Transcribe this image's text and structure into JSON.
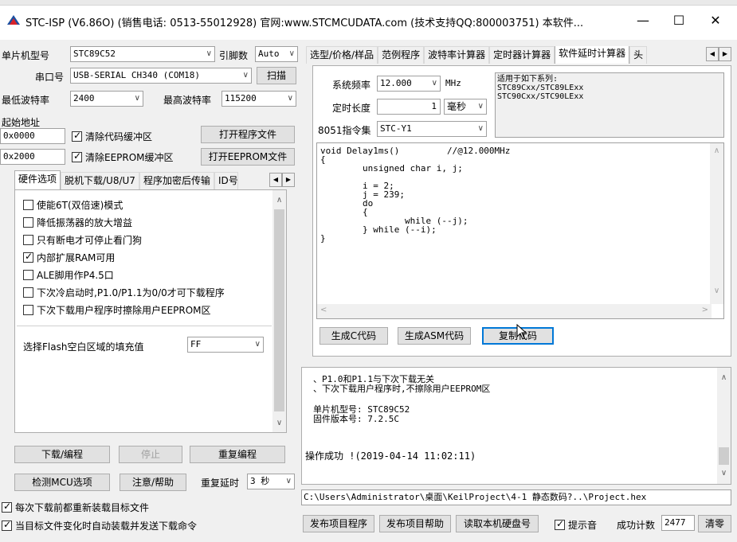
{
  "window": {
    "title": "STC-ISP (V6.86O) (销售电话: 0513-55012928) 官网:www.STCMCUDATA.com  (技术支持QQ:800003751) 本软件...",
    "minimize_glyph": "—",
    "maximize_glyph": "☐",
    "close_glyph": "✕"
  },
  "left": {
    "mcu_label": "单片机型号",
    "mcu_value": "STC89C52",
    "pins_label": "引脚数",
    "pins_value": "Auto",
    "port_label": "串口号",
    "port_value": "USB-SERIAL CH340 (COM18)",
    "scan_button": "扫描",
    "min_baud_label": "最低波特率",
    "min_baud_value": "2400",
    "max_baud_label": "最高波特率",
    "max_baud_value": "115200",
    "start_addr_label": "起始地址",
    "addr1": "0x0000",
    "clear_code_label": "清除代码缓冲区",
    "open_prog_button": "打开程序文件",
    "addr2": "0x2000",
    "clear_eeprom_label": "清除EEPROM缓冲区",
    "open_eeprom_button": "打开EEPROM文件",
    "tabs": [
      "硬件选项",
      "脱机下载/U8/U7",
      "程序加密后传输",
      "ID号"
    ],
    "options": [
      {
        "label": "使能6T(双倍速)模式",
        "checked": false
      },
      {
        "label": "降低振荡器的放大增益",
        "checked": false
      },
      {
        "label": "只有断电才可停止看门狗",
        "checked": false
      },
      {
        "label": "内部扩展RAM可用",
        "checked": true
      },
      {
        "label": "ALE脚用作P4.5口",
        "checked": false
      },
      {
        "label": "下次冷启动时,P1.0/P1.1为0/0才可下载程序",
        "checked": false
      },
      {
        "label": "下次下载用户程序时擦除用户EEPROM区",
        "checked": false
      }
    ],
    "fill_label": "选择Flash空白区域的填充值",
    "fill_value": "FF",
    "download_button": "下载/编程",
    "stop_button": "停止",
    "reprogram_button": "重复编程",
    "detect_button": "检测MCU选项",
    "help_button": "注意/帮助",
    "redelay_label": "重复延时",
    "redelay_value": "3 秒",
    "reload_label": "每次下载前都重新装载目标文件",
    "auto_label": "当目标文件变化时自动装载并发送下载命令"
  },
  "right": {
    "tabs": [
      "选型/价格/样品",
      "范例程序",
      "波特率计算器",
      "定时器计算器",
      "软件延时计算器",
      "头"
    ],
    "sysfreq_label": "系统频率",
    "sysfreq_value": "12.000",
    "mhz_label": "MHz",
    "timelen_label": "定时长度",
    "timelen_value": "1",
    "unit_value": "毫秒",
    "isa_label": "8051指令集",
    "isa_value": "STC-Y1",
    "applies_text": "适用于如下系列:\nSTC89Cxx/STC89LExx\nSTC90Cxx/STC90LExx",
    "code_text": "void Delay1ms()\t\t//@12.000MHz\n{\n\tunsigned char i, j;\n\n\ti = 2;\n\tj = 239;\n\tdo\n\t{\n\t\twhile (--j);\n\t} while (--i);\n}",
    "gen_c_button": "生成C代码",
    "gen_asm_button": "生成ASM代码",
    "copy_button": "复制代码",
    "log_lines": [
      "、P1.0和P1.1与下次下载无关",
      "、下次下载用户程序时,不擦除用户EEPROM区",
      "",
      "单片机型号: STC89C52",
      "固件版本号: 7.2.5C",
      "",
      "",
      "操作成功 !(2019-04-14 11:02:11)"
    ],
    "path": "C:\\Users\\Administrator\\桌面\\KeilProject\\4-1 静态数码?..\\Project.hex",
    "publish_prog_button": "发布项目程序",
    "publish_help_button": "发布项目帮助",
    "read_disk_button": "读取本机硬盘号",
    "sound_label": "提示音",
    "success_label": "成功计数",
    "success_value": "2477",
    "clear_button": "清零"
  }
}
